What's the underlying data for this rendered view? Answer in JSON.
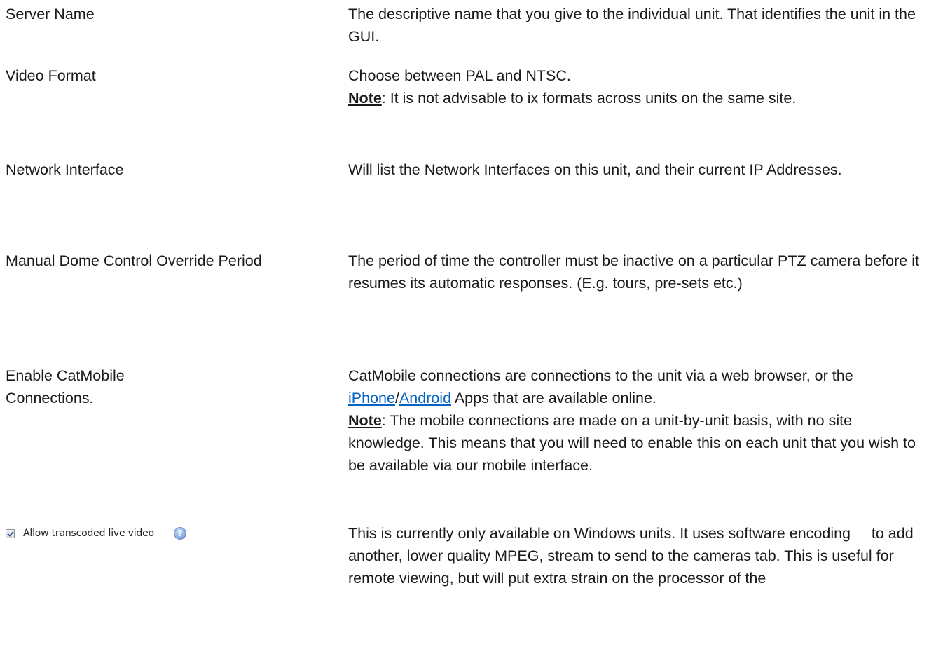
{
  "rows": [
    {
      "term": "Server Name",
      "desc": "The descriptive name that you give to the individual unit. That identifies the unit in the GUI."
    },
    {
      "term": "Video Format",
      "desc": "Choose between PAL and NTSC.",
      "note_label": "Note",
      "note_text": ": It is not advisable to ix formats across units on the same site."
    },
    {
      "term": "Network Interface",
      "desc": "Will list the Network Interfaces on this unit, and their current IP Addresses."
    },
    {
      "term": "Manual Dome Control Override Period",
      "desc": "The period of time the controller must be inactive on a particular PTZ camera before it resumes its automatic responses. (E.g. tours, pre-sets etc.)"
    },
    {
      "term_line1": "Enable CatMobile",
      "term_line2": "Connections.",
      "desc_before": "CatMobile connections are connections to the unit via a web browser, or the ",
      "link1": "iPhone",
      "separator": "/",
      "link2": "Android",
      "desc_after": " Apps that are available online.",
      "note_label": "Note",
      "note_text": ": The mobile connections are made on a unit-by-unit basis, with no site knowledge. This means that you will need to enable this on each unit that you wish to be available via our mobile interface."
    },
    {
      "checkbox_label": "Allow transcoded live video",
      "checkbox_checked": true,
      "help_glyph": "?",
      "desc": "This is currently only available on Windows units. It uses software encoding     to add another, lower quality MPEG, stream to send to the cameras tab. This is useful for remote viewing, but will put extra strain on the processor of the"
    }
  ]
}
